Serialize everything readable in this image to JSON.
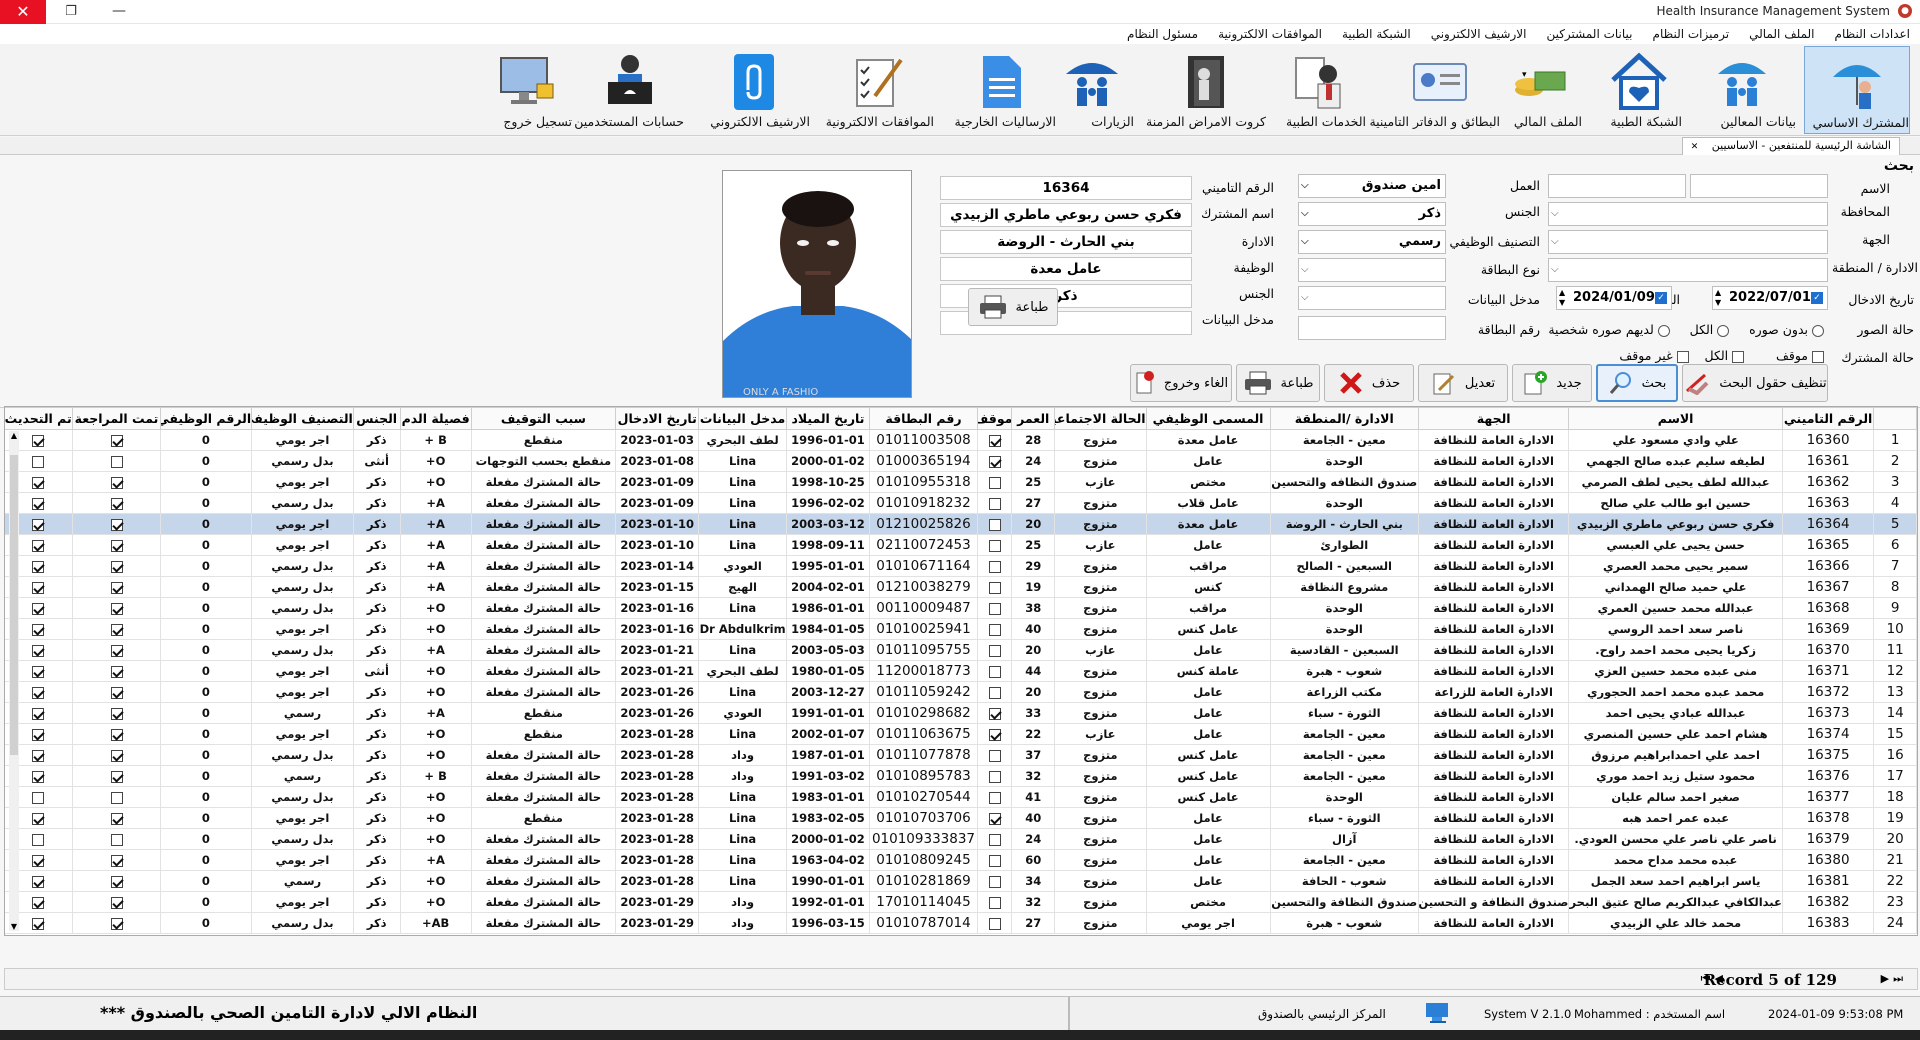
{
  "window": {
    "title": "Health Insurance Management System",
    "close": "✕",
    "restore": "❐",
    "minimize": "—"
  },
  "menu": [
    "اعدادات النظام",
    "الملف المالي",
    "ترميزات النظام",
    "بيانات المشتركين",
    "الارشيف الالكتروني",
    "الشبكة الطبية",
    "الموافقات الالكترونية",
    "مسئول النظام"
  ],
  "ribbon": [
    {
      "label": "المشترك الاساسي",
      "icon": "umbrella-person-icon"
    },
    {
      "label": "بيانات المعالين",
      "icon": "family-umbrella-icon"
    },
    {
      "label": "الشبكة الطبية",
      "icon": "medical-house-icon"
    },
    {
      "label": "الملف المالي",
      "icon": "money-icon"
    },
    {
      "label": "البطائق و الدفاتر التامينية",
      "icon": "id-card-icon"
    },
    {
      "label": "الخدمات الطبية",
      "icon": "doctor-icon"
    },
    {
      "label": "كروت الامراض المزمنة",
      "icon": "door-person-icon"
    },
    {
      "label": "الزيارات",
      "icon": "people-umbrella-icon"
    },
    {
      "label": "الارساليات الخارجية",
      "icon": "document-icon"
    },
    {
      "label": "الموافقات الالكترونية",
      "icon": "checklist-icon"
    },
    {
      "label": "الارشيف الالكتروني",
      "icon": "attachment-icon"
    },
    {
      "label": "حسابات المستخدمين",
      "icon": "user-laptop-icon"
    },
    {
      "label": "تسجيل خروج",
      "icon": "monitor-lock-icon"
    }
  ],
  "tab": {
    "label": "الشاشة الرئيسية للمنتفعين - الاساسيين",
    "close": "✕"
  },
  "search": {
    "heading": "بحث",
    "labels": {
      "name": "الاسم",
      "work": "العمل",
      "insurance_no": "الرقم التاميني",
      "governorate": "المحافظة",
      "gender": "الجنس",
      "subscriber_name": "اسم المشترك",
      "entity": "الجهة",
      "job_class": "التصنيف الوظيفي",
      "department": "الادارة",
      "dept_region": "الادارة / المنطقة",
      "card_type": "نوع البطاقة",
      "job": "الوظيفة",
      "entry_date": "تاريخ الادخال",
      "to": "الى",
      "data_entry": "مدخل البيانات",
      "gender2": "الجنس",
      "photo_status": "حالة الصور",
      "card_no": "رقم البطاقة",
      "data_entry2": "مدخل البيانات",
      "sub_status": "حالة المشترك"
    },
    "values": {
      "work": "امين صندوق",
      "gender": "ذكر",
      "job_class": "رسمي",
      "date_from": "2022/07/01",
      "date_to": "2024/01/09"
    },
    "detail": {
      "insurance_no": "16364",
      "subscriber_name": "فكري حسن ربوعي ماطري الزبيدي",
      "department": "بني الحارث - الروضة",
      "job": "عامل معدة",
      "gender": "ذكر",
      "data_entry": ""
    },
    "photo_options": [
      "بدون صوره",
      "الكل",
      "لديهم صوره شخصية"
    ],
    "status_options": [
      "موقف",
      "الكل",
      "غير موقف"
    ],
    "buttons": {
      "clear": "تنظيف حقول البحث",
      "search": "بحث",
      "new": "جديد",
      "edit": "تعديل",
      "delete": "حذف",
      "print": "طباعة",
      "cancel_exit": "الغاء وخروج",
      "print2": "طباعة"
    }
  },
  "grid": {
    "columns": [
      "الرقم التاميني",
      "الاسم",
      "الجهة",
      "الادارة /المنطقة",
      "المسمى الوظيفي",
      "الحالة الاجتماعية",
      "العمر",
      "موقف",
      "رقم البطاقة",
      "تاريخ الميلاد",
      "مدخل البيانات",
      "تاريخ الادخال",
      "سبب التوقيف",
      "فصيلة الدم",
      "الجنس",
      "التصنيف الوظيفي",
      "الرقم الوظيفي",
      "تمت المراجعة",
      "تم التحديث"
    ],
    "rows": [
      [
        "1",
        "16360",
        "علي وادي مسعود علي",
        "الادارة العامة للنظافة",
        "معين - الجامعة",
        "عامل معدة",
        "متزوج",
        "28",
        "1",
        "01011003508",
        "1996-01-01",
        "لطف البحري",
        "2023-01-03",
        "منقطع",
        "B +",
        "ذكر",
        "اجر يومي",
        "0",
        "1",
        "1"
      ],
      [
        "2",
        "16361",
        "لطيفه سليم عبده صالح الجهمي",
        "الادارة العامة للنظافة",
        "الوحدة",
        "عامل",
        "متزوج",
        "24",
        "1",
        "01000365194",
        "2000-01-02",
        "Lina",
        "2023-01-08",
        "منقطع بحسب التوجهات",
        "O+",
        "أنثى",
        "بدل رسمي",
        "0",
        "0",
        "0"
      ],
      [
        "3",
        "16362",
        "عبدالله لطف يحيى لطف الصرمي",
        "الادارة العامة للنظافة",
        "صندوق النظافه والتحسين",
        "مختص",
        "عازب",
        "25",
        "0",
        "01010955318",
        "1998-10-25",
        "Lina",
        "2023-01-09",
        "حالة المشترك مفعلة",
        "O+",
        "ذكر",
        "اجر يومي",
        "0",
        "1",
        "1"
      ],
      [
        "4",
        "16363",
        "حسين ابو طالب علي صالح",
        "الادارة العامة للنظافة",
        "الوحدة",
        "عامل قلاب",
        "متزوج",
        "27",
        "0",
        "01010918232",
        "1996-02-02",
        "Lina",
        "2023-01-09",
        "حالة المشترك مفعلة",
        "A+",
        "ذكر",
        "بدل رسمي",
        "0",
        "1",
        "1"
      ],
      [
        "5",
        "16364",
        "فكري حسن ربوعي ماطري الزبيدي",
        "الادارة العامة للنظافة",
        "بني الحارث - الروضة",
        "عامل معدة",
        "متزوج",
        "20",
        "0",
        "01210025826",
        "2003-03-12",
        "Lina",
        "2023-01-10",
        "حالة المشترك مفعلة",
        "A+",
        "ذكر",
        "اجر يومي",
        "0",
        "1",
        "1"
      ],
      [
        "6",
        "16365",
        "حسن يحيى علي العبسي",
        "الادارة العامة للنظافة",
        "الطوارئ",
        "عامل",
        "عازب",
        "25",
        "0",
        "02110072453",
        "1998-09-11",
        "Lina",
        "2023-01-10",
        "حالة المشترك مفعلة",
        "A+",
        "ذكر",
        "اجر يومي",
        "0",
        "1",
        "1"
      ],
      [
        "7",
        "16366",
        "سمير يحيى محمد العصري",
        "الادارة العامة للنظافة",
        "السبعين - الصالح",
        "مراقب",
        "متزوج",
        "29",
        "0",
        "01010671164",
        "1995-01-01",
        "العودي",
        "2023-01-14",
        "حالة المشترك مفعلة",
        "A+",
        "ذكر",
        "بدل رسمي",
        "0",
        "1",
        "1"
      ],
      [
        "8",
        "16367",
        "علي حميد صالح الهمداني",
        "الادارة العامة للنظافة",
        "مشروع النظافة",
        "كنس",
        "متزوج",
        "19",
        "0",
        "01210038279",
        "2004-02-01",
        "الهيج",
        "2023-01-15",
        "حالة المشترك مفعلة",
        "A+",
        "ذكر",
        "بدل رسمي",
        "0",
        "1",
        "1"
      ],
      [
        "9",
        "16368",
        "عبدالله محمد حسين العمري",
        "الادارة العامة للنظافة",
        "الوحدة",
        "مراقب",
        "متزوج",
        "38",
        "0",
        "00110009487",
        "1986-01-01",
        "Lina",
        "2023-01-16",
        "حالة المشترك مفعلة",
        "O+",
        "ذكر",
        "بدل رسمي",
        "0",
        "1",
        "1"
      ],
      [
        "10",
        "16369",
        "ناصر سعد احمد الروسي",
        "الادارة العامة للنظافة",
        "الوحدة",
        "عامل كنس",
        "متزوج",
        "40",
        "0",
        "01010025941",
        "1984-01-05",
        "Dr Abdulkrim",
        "2023-01-16",
        "حالة المشترك مفعلة",
        "O+",
        "ذكر",
        "اجر يومي",
        "0",
        "1",
        "1"
      ],
      [
        "11",
        "16370",
        "زكريا يحيى محمد احمد راوح.",
        "الادارة العامة للنظافة",
        "السبعين - القادسية",
        "عامل",
        "عازب",
        "20",
        "0",
        "01011095755",
        "2003-05-03",
        "Lina",
        "2023-01-21",
        "حالة المشترك مفعلة",
        "A+",
        "ذكر",
        "بدل رسمي",
        "0",
        "1",
        "1"
      ],
      [
        "12",
        "16371",
        "منى عبده محمد حسين العزي",
        "الادارة العامة للنظافة",
        "شعوب - هبرة",
        "عاملة كنس",
        "متزوج",
        "44",
        "0",
        "11200018773",
        "1980-01-05",
        "لطف البحري",
        "2023-01-21",
        "حالة المشترك مفعلة",
        "O+",
        "أنثى",
        "اجر يومي",
        "0",
        "1",
        "1"
      ],
      [
        "13",
        "16372",
        "محمد عبده محمد احمد الحجوري",
        "الادارة العامة للزراعة",
        "مكتب الزراعة",
        "عامل",
        "متزوج",
        "20",
        "0",
        "01011059242",
        "2003-12-27",
        "Lina",
        "2023-01-26",
        "حالة المشترك مفعلة",
        "O+",
        "ذكر",
        "اجر يومي",
        "0",
        "1",
        "1"
      ],
      [
        "14",
        "16373",
        "عبدالله عبادي يحيى احمد",
        "الادارة العامة للنظافة",
        "الثورة - سباء",
        "عامل",
        "متزوج",
        "33",
        "1",
        "01010298682",
        "1991-01-01",
        "العودي",
        "2023-01-26",
        "منقطع",
        "A+",
        "ذكر",
        "رسمي",
        "0",
        "1",
        "1"
      ],
      [
        "15",
        "16374",
        "هشام احمد علي حسين المنصري",
        "الادارة العامة للنظافة",
        "معين - الجامعة",
        "عامل",
        "عازب",
        "22",
        "1",
        "01011063675",
        "2002-01-07",
        "Lina",
        "2023-01-28",
        "منقطع",
        "O+",
        "ذكر",
        "اجر يومي",
        "0",
        "1",
        "1"
      ],
      [
        "16",
        "16375",
        "احمد علي احمدابراهيم مرزوق",
        "الادارة العامة للنظافة",
        "معين - الجامعة",
        "عامل كنس",
        "متزوج",
        "37",
        "0",
        "01011077878",
        "1987-01-01",
        "وداد",
        "2023-01-28",
        "حالة المشترك مفعلة",
        "O+",
        "ذكر",
        "بدل رسمي",
        "0",
        "1",
        "1"
      ],
      [
        "17",
        "16376",
        "محمود ستيل زيد احمد موري",
        "الادارة العامة للنظافة",
        "معين - الجامعة",
        "عامل كنس",
        "متزوج",
        "32",
        "0",
        "01010895783",
        "1991-03-02",
        "وداد",
        "2023-01-28",
        "حالة المشترك مفعلة",
        "B +",
        "ذكر",
        "رسمي",
        "0",
        "1",
        "1"
      ],
      [
        "18",
        "16377",
        "صغير احمد سالم عليان",
        "الادارة العامة للنظافة",
        "الوحدة",
        "عامل كنس",
        "متزوج",
        "41",
        "0",
        "01010270544",
        "1983-01-01",
        "Lina",
        "2023-01-28",
        "حالة المشترك مفعلة",
        "O+",
        "ذكر",
        "بدل رسمي",
        "0",
        "0",
        "0"
      ],
      [
        "19",
        "16378",
        "عبده عمر احمد هبه",
        "الادارة العامة للنظافة",
        "الثورة - سباء",
        "عامل",
        "متزوج",
        "40",
        "1",
        "01010703706",
        "1983-02-05",
        "Lina",
        "2023-01-28",
        "منقطع",
        "O+",
        "ذكر",
        "اجر يومي",
        "0",
        "1",
        "1"
      ],
      [
        "20",
        "16379",
        "ناصر علي ناصر علي محسن العودي.",
        "الادارة العامة للنظافة",
        "آزال",
        "عامل",
        "متزوج",
        "24",
        "0",
        "010109333837",
        "2000-01-02",
        "Lina",
        "2023-01-28",
        "حالة المشترك مفعلة",
        "O+",
        "ذكر",
        "بدل رسمي",
        "0",
        "0",
        "0"
      ],
      [
        "21",
        "16380",
        "عبده محمد مداح محمد",
        "الادارة العامة للنظافة",
        "معين - الجامعة",
        "عامل",
        "متزوج",
        "60",
        "0",
        "01010809245",
        "1963-04-02",
        "Lina",
        "2023-01-28",
        "حالة المشترك مفعلة",
        "A+",
        "ذكر",
        "اجر يومي",
        "0",
        "1",
        "1"
      ],
      [
        "22",
        "16381",
        "ياسر ابراهيم احمد سعد الجمل",
        "الادارة العامة للنظافة",
        "شعوب - الحافة",
        "عامل",
        "متزوج",
        "34",
        "0",
        "01010281869",
        "1990-01-01",
        "Lina",
        "2023-01-28",
        "حالة المشترك مفعلة",
        "O+",
        "ذكر",
        "رسمي",
        "0",
        "1",
        "1"
      ],
      [
        "23",
        "16382",
        "عبدالكافي عبدالكريم صالح عتيق البحري",
        "صندوق النظافة و التحسين",
        "صندوق النظافة والتحسين",
        "مختص",
        "متزوج",
        "32",
        "0",
        "17010114045",
        "1992-01-01",
        "وداد",
        "2023-01-29",
        "حالة المشترك مفعلة",
        "O+",
        "ذكر",
        "اجر يومي",
        "0",
        "1",
        "1"
      ],
      [
        "24",
        "16383",
        "محمد خالد علي الزبيدي",
        "الادارة العامة للنظافة",
        "شعوب - هبرة",
        "اجر يومي",
        "متزوج",
        "27",
        "0",
        "01010787014",
        "1996-03-15",
        "وداد",
        "2023-01-29",
        "حالة المشترك مفعلة",
        "AB+",
        "ذكر",
        "بدل رسمي",
        "0",
        "1",
        "1"
      ]
    ],
    "selected_row": 5
  },
  "nav": {
    "record": "Record 5 of 129",
    "first": "⏮",
    "prev": "◀",
    "next": "▶",
    "last": "⏭"
  },
  "status": {
    "message": "النظام الالي لادارة التامين الصحي بالصندوق ***",
    "center": "المركز الرئيسي بالصندوق",
    "version": "System V 2.1.0",
    "user": "Mohammed : اسم المستخدم",
    "datetime": "2024-01-09 9:53:08 PM"
  },
  "colors": {
    "selected_row": "#c5d5ea",
    "close_red": "#e81123",
    "ribbon_selected": "#cfe3f7"
  }
}
